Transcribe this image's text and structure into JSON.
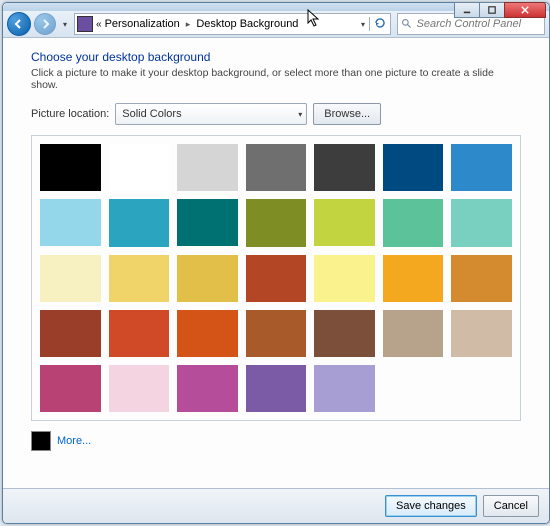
{
  "breadcrumb": {
    "back_label": "Back",
    "item0": "Personalization",
    "item1": "Desktop Background"
  },
  "search": {
    "placeholder": "Search Control Panel"
  },
  "page": {
    "title": "Choose your desktop background",
    "subtitle": "Click a picture to make it your desktop background, or select more than one picture to create a slide show."
  },
  "location": {
    "label": "Picture location:",
    "selected": "Solid Colors",
    "browse": "Browse..."
  },
  "swatches": [
    "#000000",
    "#ffffff",
    "#d5d5d5",
    "#6f6f6f",
    "#3d3d3d",
    "#004a82",
    "#2d89c9",
    "#95d7ea",
    "#2ba4bf",
    "#007173",
    "#7e8e24",
    "#c3d441",
    "#5bc29a",
    "#7ad0c0",
    "#f7f1c2",
    "#f0d46a",
    "#e1bf49",
    "#b34725",
    "#f9f28d",
    "#f4a81f",
    "#d48b2f",
    "#9a3e2a",
    "#d04a27",
    "#d45417",
    "#a85a2a",
    "#7c4f3a",
    "#b7a28b",
    "#d0bca6",
    "#b94275",
    "#f4d4e0",
    "#b64d9a",
    "#7b5aa6",
    "#a79ed4",
    "#ffffff",
    "#ffffff"
  ],
  "visible_swatch_count": 33,
  "more": {
    "link": "More...",
    "color": "#000000"
  },
  "footer": {
    "save": "Save changes",
    "cancel": "Cancel"
  }
}
